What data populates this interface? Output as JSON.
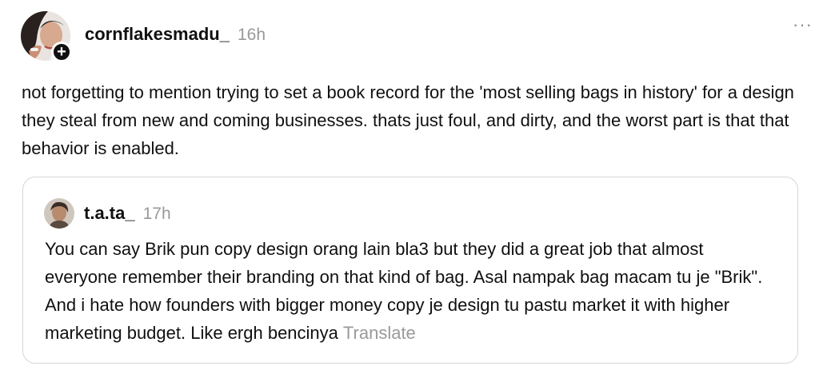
{
  "post": {
    "username": "cornflakesmadu_",
    "time": "16h",
    "text": "not forgetting to mention trying to set a book record for the 'most selling bags in history' for a design they steal from new and coming businesses. thats just foul, and dirty, and the worst part is that that behavior is enabled.",
    "follow_badge": "+",
    "more_label": "···",
    "avatar_icon": "user-avatar-icon"
  },
  "quote": {
    "username": "t.a.ta_",
    "time": "17h",
    "text": "You can say Brik pun copy design orang lain bla3 but they did a great job that almost everyone remember their branding on that kind of bag. Asal nampak bag macam tu je \"Brik\". And i hate how founders with bigger money copy je design tu pastu market it with higher marketing budget. Like ergh bencinya",
    "translate_label": "Translate"
  },
  "colors": {
    "text": "#101010",
    "muted": "#999999",
    "card_border": "#d6d6d6",
    "background": "#ffffff"
  }
}
